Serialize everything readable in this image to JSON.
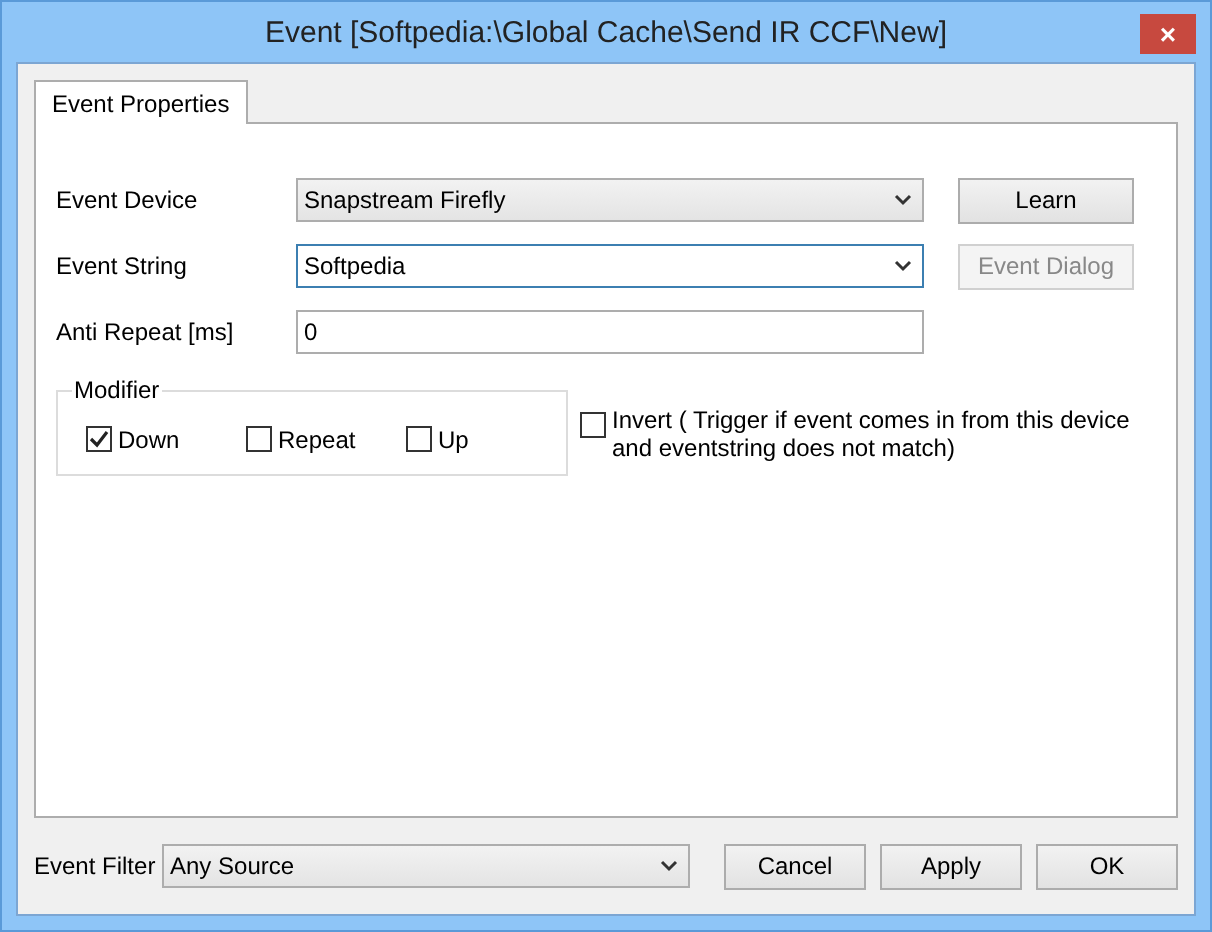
{
  "window": {
    "title": "Event [Softpedia:\\Global Cache\\Send IR CCF\\New]",
    "close": "×"
  },
  "tabs": [
    {
      "label": "Event Properties",
      "selected": true
    }
  ],
  "fields": [
    {
      "label": "Event Device",
      "kind": "combo",
      "value": "Snapstream Firefly",
      "focused": false,
      "button": {
        "label": "Learn",
        "disabled": false
      }
    },
    {
      "label": "Event String",
      "kind": "combo-edit",
      "value": "Softpedia",
      "focused": true,
      "button": {
        "label": "Event Dialog",
        "disabled": true
      }
    },
    {
      "label": "Anti Repeat [ms]",
      "kind": "text",
      "value": "0",
      "focused": false
    }
  ],
  "modifier": {
    "title": "Modifier",
    "options": [
      {
        "label": "Down",
        "checked": true
      },
      {
        "label": "Repeat",
        "checked": false
      },
      {
        "label": "Up",
        "checked": false
      }
    ]
  },
  "invert": {
    "label": "Invert ( Trigger if event comes in from this device and eventstring does not match)",
    "checked": false
  },
  "event_filter": {
    "label": "Event Filter",
    "value": "Any Source"
  },
  "buttons": [
    "Cancel",
    "Apply",
    "OK"
  ]
}
